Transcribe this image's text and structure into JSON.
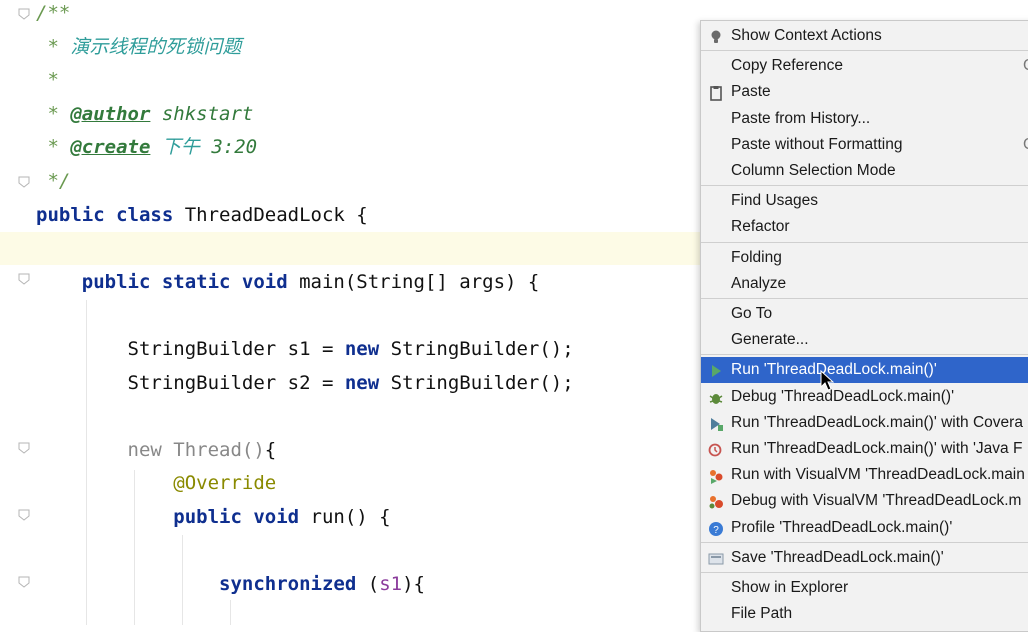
{
  "editor": {
    "lines": [
      {
        "tokens": [
          {
            "t": "/**",
            "c": "cmt"
          }
        ]
      },
      {
        "tokens": [
          {
            "t": " * ",
            "c": "cmt"
          },
          {
            "t": "演示线程的死锁问题",
            "c": "cmt-zh"
          }
        ]
      },
      {
        "tokens": [
          {
            "t": " *",
            "c": "cmt"
          }
        ]
      },
      {
        "tokens": [
          {
            "t": " * ",
            "c": "cmt"
          },
          {
            "t": "@author",
            "c": "tag"
          },
          {
            "t": " shkstart",
            "c": "tagv"
          }
        ]
      },
      {
        "tokens": [
          {
            "t": " * ",
            "c": "cmt"
          },
          {
            "t": "@create",
            "c": "tag"
          },
          {
            "t": " ",
            "c": "cmt"
          },
          {
            "t": "下午",
            "c": "cmt-zh"
          },
          {
            "t": " 3:20",
            "c": "tagv"
          }
        ]
      },
      {
        "tokens": [
          {
            "t": " */",
            "c": "cmt"
          }
        ]
      },
      {
        "tokens": [
          {
            "t": "public class ",
            "c": "k"
          },
          {
            "t": "ThreadDeadLock {",
            "c": ""
          }
        ]
      },
      {
        "tokens": [
          {
            "t": "",
            "c": ""
          }
        ]
      },
      {
        "tokens": [
          {
            "t": "    public static void ",
            "c": "k"
          },
          {
            "t": "main(String[] args) {",
            "c": ""
          }
        ]
      },
      {
        "tokens": [
          {
            "t": "",
            "c": ""
          }
        ]
      },
      {
        "tokens": [
          {
            "t": "        StringBuilder s1 = ",
            "c": ""
          },
          {
            "t": "new ",
            "c": "k"
          },
          {
            "t": "StringBuilder();",
            "c": ""
          }
        ]
      },
      {
        "tokens": [
          {
            "t": "        StringBuilder s2 = ",
            "c": ""
          },
          {
            "t": "new ",
            "c": "k"
          },
          {
            "t": "StringBuilder();",
            "c": ""
          }
        ]
      },
      {
        "tokens": [
          {
            "t": "",
            "c": ""
          }
        ]
      },
      {
        "tokens": [
          {
            "t": "        new Thread()",
            "c": "gry"
          },
          {
            "t": "{",
            "c": ""
          }
        ]
      },
      {
        "tokens": [
          {
            "t": "            @Override",
            "c": "ann"
          }
        ]
      },
      {
        "tokens": [
          {
            "t": "            public void ",
            "c": "k"
          },
          {
            "t": "run() {",
            "c": ""
          }
        ]
      },
      {
        "tokens": [
          {
            "t": "",
            "c": ""
          }
        ]
      },
      {
        "tokens": [
          {
            "t": "                synchronized ",
            "c": "k"
          },
          {
            "t": "(",
            "c": ""
          },
          {
            "t": "s1",
            "c": "pur"
          },
          {
            "t": "){",
            "c": ""
          }
        ]
      }
    ]
  },
  "menu": {
    "items": [
      {
        "label": "Show Context Actions",
        "icon": "lightbulb-icon",
        "name": "show-context-actions"
      },
      {
        "sep": true
      },
      {
        "label": "Copy Reference",
        "icon": "",
        "name": "copy-reference",
        "shortcut": "C"
      },
      {
        "label": "Paste",
        "icon": "clipboard-icon",
        "name": "paste"
      },
      {
        "label": "Paste from History...",
        "icon": "",
        "name": "paste-from-history"
      },
      {
        "label": "Paste without Formatting",
        "icon": "",
        "name": "paste-without-formatting",
        "shortcut": "C"
      },
      {
        "label": "Column Selection Mode",
        "icon": "",
        "name": "column-selection-mode"
      },
      {
        "sep": true
      },
      {
        "label": "Find Usages",
        "icon": "",
        "name": "find-usages"
      },
      {
        "label": "Refactor",
        "icon": "",
        "name": "refactor"
      },
      {
        "sep": true
      },
      {
        "label": "Folding",
        "icon": "",
        "name": "folding"
      },
      {
        "label": "Analyze",
        "icon": "",
        "name": "analyze"
      },
      {
        "sep": true
      },
      {
        "label": "Go To",
        "icon": "",
        "name": "go-to"
      },
      {
        "label": "Generate...",
        "icon": "",
        "name": "generate"
      },
      {
        "sep": true
      },
      {
        "label": "Run 'ThreadDeadLock.main()'",
        "icon": "run-icon",
        "name": "run-main",
        "selected": true
      },
      {
        "label": "Debug 'ThreadDeadLock.main()'",
        "icon": "debug-icon",
        "name": "debug-main"
      },
      {
        "label": "Run 'ThreadDeadLock.main()' with Covera",
        "icon": "coverage-icon",
        "name": "run-with-coverage"
      },
      {
        "label": "Run 'ThreadDeadLock.main()' with 'Java F",
        "icon": "profiler-icon",
        "name": "run-with-java-flight"
      },
      {
        "label": "Run with VisualVM 'ThreadDeadLock.main",
        "icon": "visualvm-run-icon",
        "name": "run-with-visualvm"
      },
      {
        "label": "Debug with VisualVM 'ThreadDeadLock.m",
        "icon": "visualvm-debug-icon",
        "name": "debug-with-visualvm"
      },
      {
        "label": "Profile 'ThreadDeadLock.main()'",
        "icon": "profile-icon",
        "name": "profile-main"
      },
      {
        "sep": true
      },
      {
        "label": "Save 'ThreadDeadLock.main()'",
        "icon": "save-config-icon",
        "name": "save-main"
      },
      {
        "sep": true
      },
      {
        "label": "Show in Explorer",
        "icon": "",
        "name": "show-in-explorer"
      },
      {
        "label": "File Path",
        "icon": "",
        "name": "file-path"
      }
    ]
  },
  "colors": {
    "selection": "#2f65ca",
    "menu_bg": "#f2f2f2",
    "current_line": "#fdfbe6"
  }
}
